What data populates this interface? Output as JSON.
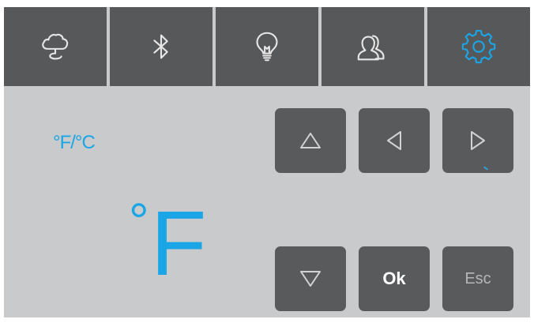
{
  "tabs": [
    {
      "icon": "cloud-icon",
      "color": "#e6e6e6"
    },
    {
      "icon": "bluetooth-icon",
      "color": "#e6e6e6"
    },
    {
      "icon": "lightbulb-icon",
      "color": "#e6e6e6"
    },
    {
      "icon": "users-icon",
      "color": "#e6e6e6"
    },
    {
      "icon": "gear-icon",
      "color": "#1aa6e6",
      "active": true
    }
  ],
  "settings": {
    "label": "°F/°C",
    "unit_symbol": "°",
    "unit_letter": "F"
  },
  "keys": {
    "up": {
      "icon": "triangle-up-icon"
    },
    "left": {
      "icon": "triangle-left-icon"
    },
    "right": {
      "icon": "triangle-right-icon"
    },
    "down": {
      "icon": "triangle-down-icon"
    },
    "ok_label": "Ok",
    "esc_label": "Esc"
  },
  "colors": {
    "accent": "#1aa6e6",
    "panel": "#c8cacc",
    "tab_bg": "#57585a",
    "key_bg": "#595a5c",
    "icon_light": "#e6e6e6",
    "key_icon": "#d0d2d4"
  }
}
